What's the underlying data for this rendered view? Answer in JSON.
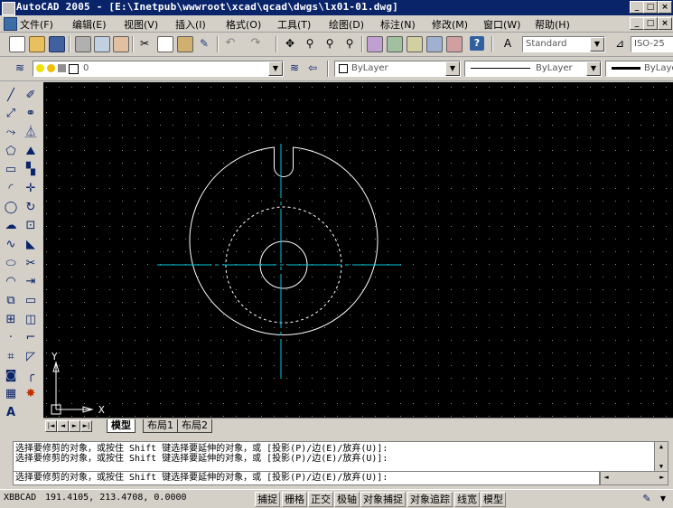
{
  "window": {
    "title": "AutoCAD 2005 - [E:\\Inetpub\\wwwroot\\xcad\\qcad\\dwgs\\lx01-01.dwg]",
    "minimize": "_",
    "restore": "□",
    "close": "×"
  },
  "menu": {
    "items": [
      "文件(F)",
      "编辑(E)",
      "视图(V)",
      "插入(I)",
      "格式(O)",
      "工具(T)",
      "绘图(D)",
      "标注(N)",
      "修改(M)",
      "窗口(W)",
      "帮助(H)"
    ]
  },
  "toolbar": {
    "text_style": "Standard",
    "dim_style": "ISO-25",
    "layer_value": "0",
    "color_value": "ByLayer",
    "linetype_value": "ByLayer",
    "lineweight_value": "ByLayer"
  },
  "canvas": {
    "background": "#000000",
    "ucs_x": "X",
    "ucs_y": "Y",
    "colors": {
      "geometry": "#ffffff",
      "centerline": "#00c8d8",
      "ucs": "#ffffff"
    }
  },
  "tabs": {
    "items": [
      "模型",
      "布局1",
      "布局2"
    ],
    "nav": [
      "|◄",
      "◄",
      "►",
      "►|"
    ]
  },
  "command": {
    "lines": [
      "选择要修剪的对象，或按住 Shift 键选择要延伸的对象，或 [投影(P)/边(E)/放弃(U)]:",
      "选择要修剪的对象，或按住 Shift 键选择要延伸的对象，或 [投影(P)/边(E)/放弃(U)]:"
    ],
    "input": "选择要修剪的对象，或按住 Shift 键选择要延伸的对象，或 [投影(P)/边(E)/放弃(U)]:"
  },
  "status": {
    "app_label": "XBBCAD",
    "coordinates": "191.4105, 213.4708, 0.0000",
    "buttons": [
      "捕捉",
      "栅格",
      "正交",
      "极轴",
      "对象捕捉",
      "对象追踪",
      "线宽",
      "模型"
    ]
  }
}
